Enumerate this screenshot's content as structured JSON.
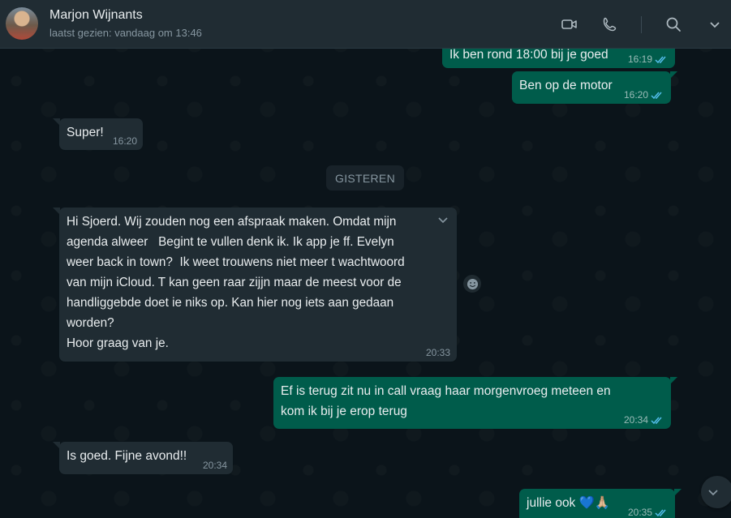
{
  "header": {
    "contact_name": "Marjon Wijnants",
    "last_seen": "laatst gezien: vandaag om 13:46",
    "icons": [
      "video-call-icon",
      "phone-icon",
      "search-icon",
      "chevron-down-icon"
    ]
  },
  "date_separator": "GISTEREN",
  "messages": [
    {
      "direction": "out",
      "text": "Ik ben rond 18:00 bij je goed",
      "time": "16:19",
      "status": "read"
    },
    {
      "direction": "out",
      "text": "Ben op de motor",
      "time": "16:20",
      "status": "read"
    },
    {
      "direction": "in",
      "text": "Super!",
      "time": "16:20"
    },
    {
      "direction": "in",
      "text": "Hi Sjoerd. Wij zouden nog een afspraak maken. Omdat mijn\nagenda alweer   Begint te vullen denk ik. Ik app je ff. Evelyn\nweer back in town?  Ik weet trouwens niet meer t wachtwoord\nvan mijn iCloud. T kan geen raar zijjn maar de meest voor de\nhandliggebde doet ie niks op. Kan hier nog iets aan gedaan\nworden?\nHoor graag van je.",
      "time": "20:33"
    },
    {
      "direction": "out",
      "text": "Ef is terug zit nu in call vraag haar morgenvroeg meteen en\nkom ik bij je erop terug",
      "time": "20:34",
      "status": "read"
    },
    {
      "direction": "in",
      "text": "Is goed. Fijne avond!!",
      "time": "20:34"
    },
    {
      "direction": "out",
      "text": "jullie ook 💙🙏🏼",
      "time": "20:35",
      "status": "read"
    }
  ],
  "colors": {
    "background": "#0b141a",
    "header": "#202c33",
    "incoming_bubble": "#202c33",
    "outgoing_bubble": "#005c4b",
    "read_ticks": "#53bdeb"
  }
}
